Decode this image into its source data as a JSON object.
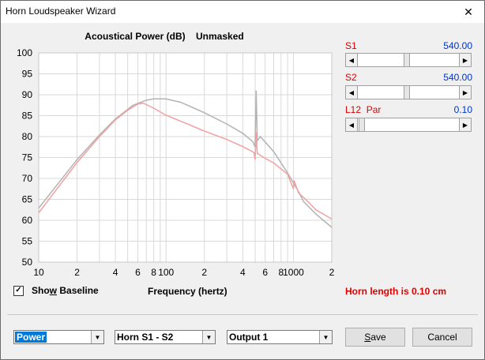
{
  "window": {
    "title": "Horn Loudspeaker Wizard",
    "close_glyph": "✕"
  },
  "chart_data": {
    "type": "line",
    "title": "Acoustical Power (dB)",
    "subtitle": "Unmasked",
    "xlabel": "Frequency (hertz)",
    "ylabel": "",
    "xscale": "log",
    "xlim": [
      10,
      2000
    ],
    "ylim": [
      50,
      100
    ],
    "yticks": [
      50,
      55,
      60,
      65,
      70,
      75,
      80,
      85,
      90,
      95,
      100
    ],
    "xtick_labels": [
      {
        "x": 10,
        "label": "10"
      },
      {
        "x": 20,
        "label": "2"
      },
      {
        "x": 40,
        "label": "4"
      },
      {
        "x": 60,
        "label": "6"
      },
      {
        "x": 80,
        "label": "8"
      },
      {
        "x": 100,
        "label": "100"
      },
      {
        "x": 200,
        "label": "2"
      },
      {
        "x": 400,
        "label": "4"
      },
      {
        "x": 600,
        "label": "6"
      },
      {
        "x": 800,
        "label": "8"
      },
      {
        "x": 1000,
        "label": "1000"
      },
      {
        "x": 2000,
        "label": "2"
      }
    ],
    "grid": true,
    "series": [
      {
        "color": "#b3b3b3",
        "points": [
          [
            10,
            62.9
          ],
          [
            20,
            74.5
          ],
          [
            30,
            80.4
          ],
          [
            40,
            84.2
          ],
          [
            55,
            87.5
          ],
          [
            70,
            88.7
          ],
          [
            80,
            89
          ],
          [
            100,
            89
          ],
          [
            130,
            88.2
          ],
          [
            200,
            85.7
          ],
          [
            300,
            83
          ],
          [
            400,
            80.8
          ],
          [
            480,
            78.8
          ],
          [
            500,
            77.5
          ],
          [
            510,
            91
          ],
          [
            520,
            79
          ],
          [
            550,
            80
          ],
          [
            700,
            76.4
          ],
          [
            900,
            71.3
          ],
          [
            1100,
            66.8
          ],
          [
            1200,
            64.5
          ],
          [
            1500,
            61.5
          ],
          [
            2000,
            58.3
          ]
        ]
      },
      {
        "color": "#f0a0a0",
        "points": [
          [
            10,
            61.8
          ],
          [
            20,
            73.8
          ],
          [
            30,
            80
          ],
          [
            40,
            84
          ],
          [
            50,
            86.3
          ],
          [
            60,
            87.8
          ],
          [
            66,
            88
          ],
          [
            80,
            86.8
          ],
          [
            100,
            85.1
          ],
          [
            150,
            82.9
          ],
          [
            200,
            81.3
          ],
          [
            300,
            79.3
          ],
          [
            400,
            77.6
          ],
          [
            490,
            76.2
          ],
          [
            500,
            74.5
          ],
          [
            510,
            81
          ],
          [
            520,
            76
          ],
          [
            600,
            74.8
          ],
          [
            700,
            73.7
          ],
          [
            900,
            71
          ],
          [
            1000,
            67.5
          ],
          [
            1010,
            69.5
          ],
          [
            1100,
            66.5
          ],
          [
            1300,
            64.5
          ],
          [
            1500,
            62.5
          ],
          [
            2000,
            60.3
          ]
        ]
      }
    ]
  },
  "controls": {
    "s1": {
      "label": "S1",
      "value": "540.00",
      "level": 0.48
    },
    "s2": {
      "label": "S2",
      "value": "540.00",
      "level": 0.48
    },
    "l12": {
      "label": "L12",
      "mode": "Par",
      "value": "0.10",
      "level": 0.0
    }
  },
  "show_baseline": {
    "label_pre": "Sho",
    "label_u": "w",
    "label_post": " Baseline",
    "checked": true,
    "mark": "✓"
  },
  "horn_length": "Horn length is 0.10 cm",
  "combos": {
    "quantity": "Power",
    "horn": "Horn S1 - S2",
    "output": "Output 1",
    "dropdown_glyph": "▼"
  },
  "buttons": {
    "save_u": "S",
    "save_rest": "ave",
    "cancel": "Cancel"
  },
  "glyphs": {
    "left": "◀",
    "right": "▶"
  }
}
